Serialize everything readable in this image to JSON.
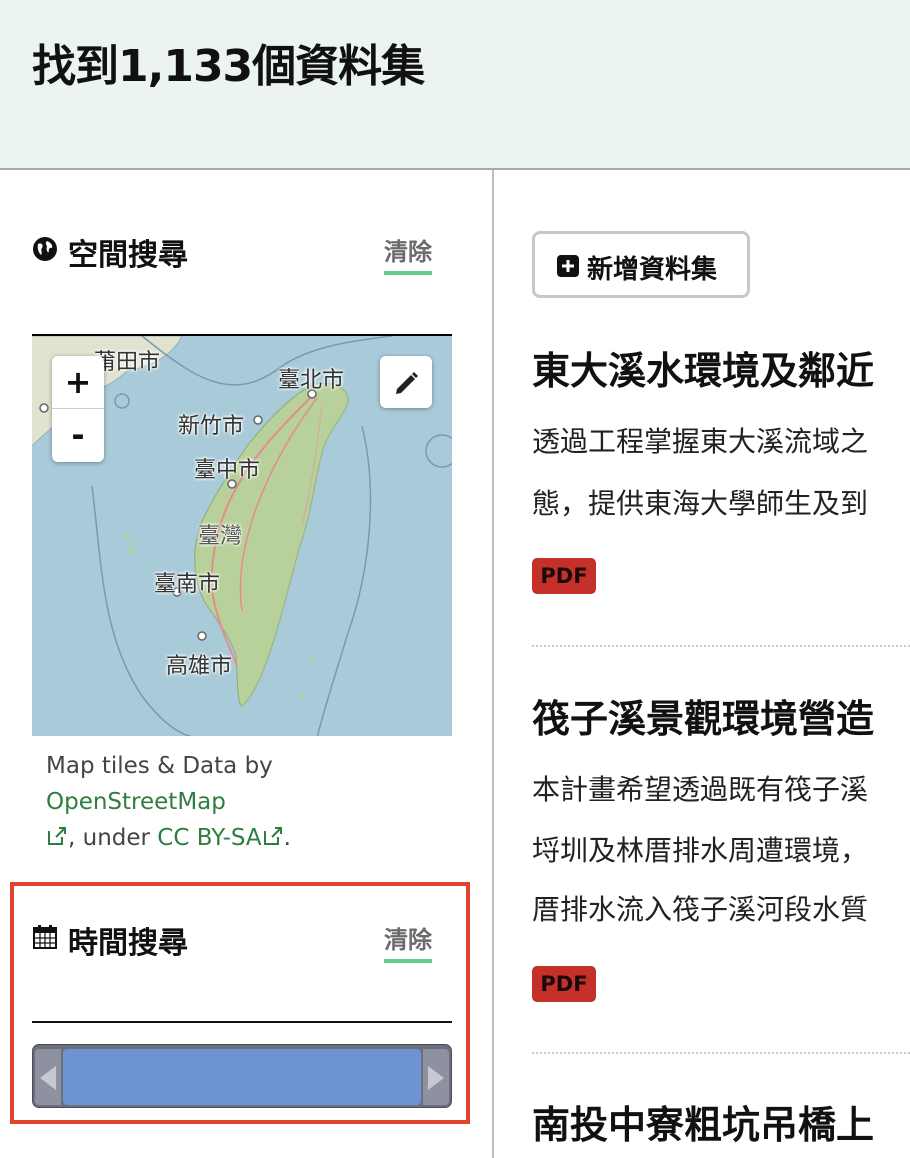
{
  "header": {
    "title": "找到1,133個資料集"
  },
  "sidebar": {
    "spatial": {
      "title": "空間搜尋",
      "clear_label": "清除",
      "icon": "globe-icon",
      "map": {
        "zoom_in": "+",
        "zoom_out": "-",
        "cities": [
          "莆田市",
          "臺北市",
          "新竹市",
          "臺中市",
          "臺灣",
          "臺南市",
          "高雄市"
        ]
      },
      "attribution": {
        "prefix": "Map tiles & Data by ",
        "osm_link": "OpenStreetMap",
        "middle": ", under ",
        "license_link": "CC BY-SA",
        "suffix": "."
      }
    },
    "temporal": {
      "title": "時間搜尋",
      "clear_label": "清除",
      "icon": "calendar-icon"
    }
  },
  "main": {
    "add_dataset_label": "新增資料集",
    "datasets": [
      {
        "title": "東大溪水環境及鄰近",
        "lines": [
          "透過工程掌握東大溪流域之",
          "態，提供東海大學師生及到"
        ],
        "format": "PDF"
      },
      {
        "title": "筏子溪景觀環境營造",
        "lines": [
          "本計畫希望透過既有筏子溪",
          "埒圳及林厝排水周遭環境，",
          "厝排水流入筏子溪河段水質"
        ],
        "format": "PDF"
      },
      {
        "title": "南投中寮粗坑吊橋上",
        "lines": [],
        "format": ""
      }
    ]
  },
  "colors": {
    "header_bg": "#ebf4ee",
    "clear_underline": "#63cf8a",
    "highlight_border": "#e0442b",
    "pdf_badge": "#c5302b",
    "slider_fill": "#6d94d2",
    "link": "#2f7d3f"
  }
}
